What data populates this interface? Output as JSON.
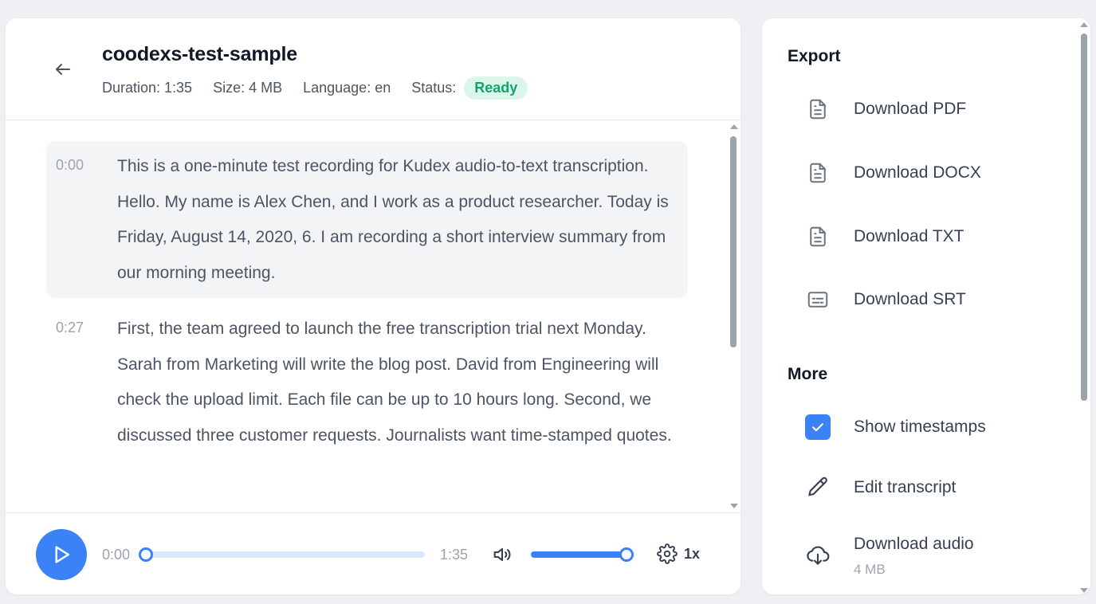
{
  "file": {
    "title": "coodexs-test-sample",
    "duration": "Duration: 1:35",
    "size": "Size: 4 MB",
    "language": "Language: en",
    "status_label": "Status:",
    "status": "Ready"
  },
  "transcript": {
    "segments": [
      {
        "time": "0:00",
        "text": " This is a one-minute test recording for Kudex audio-to-text transcription. Hello. My name is Alex Chen, and I work as a product researcher. Today is Friday, August 14, 2020, 6. I am recording a short interview summary from our morning meeting."
      },
      {
        "time": "0:27",
        "text": " First, the team agreed to launch the free transcription trial next Monday. Sarah from Marketing will write the blog post. David from Engineering will check the upload limit. Each file can be up to 10 hours long. Second, we discussed three customer requests. Journalists want time-stamped quotes."
      }
    ]
  },
  "player": {
    "current_time": "0:00",
    "total_time": "1:35",
    "progress": 0.0,
    "volume": 1.0,
    "speed": "1x",
    "icons": [
      "play-icon",
      "volume-icon",
      "gear-icon"
    ]
  },
  "side": {
    "export_title": "Export",
    "export_items": [
      {
        "label": "Download PDF",
        "icon": "document-icon"
      },
      {
        "label": "Download DOCX",
        "icon": "document-icon"
      },
      {
        "label": "Download TXT",
        "icon": "document-icon"
      },
      {
        "label": "Download SRT",
        "icon": "subtitles-icon"
      }
    ],
    "more_title": "More",
    "show_timestamps": {
      "label": "Show timestamps",
      "checked": true
    },
    "edit_transcript": {
      "label": "Edit transcript",
      "icon": "pencil-icon"
    },
    "download_audio": {
      "label": "Download audio",
      "size": "4 MB",
      "icon": "cloud-download-icon"
    }
  },
  "colors": {
    "accent": "#3b82f6",
    "status_bg": "#dcf5ea",
    "status_text": "#16a36b",
    "page_bg": "#eef0f4"
  }
}
